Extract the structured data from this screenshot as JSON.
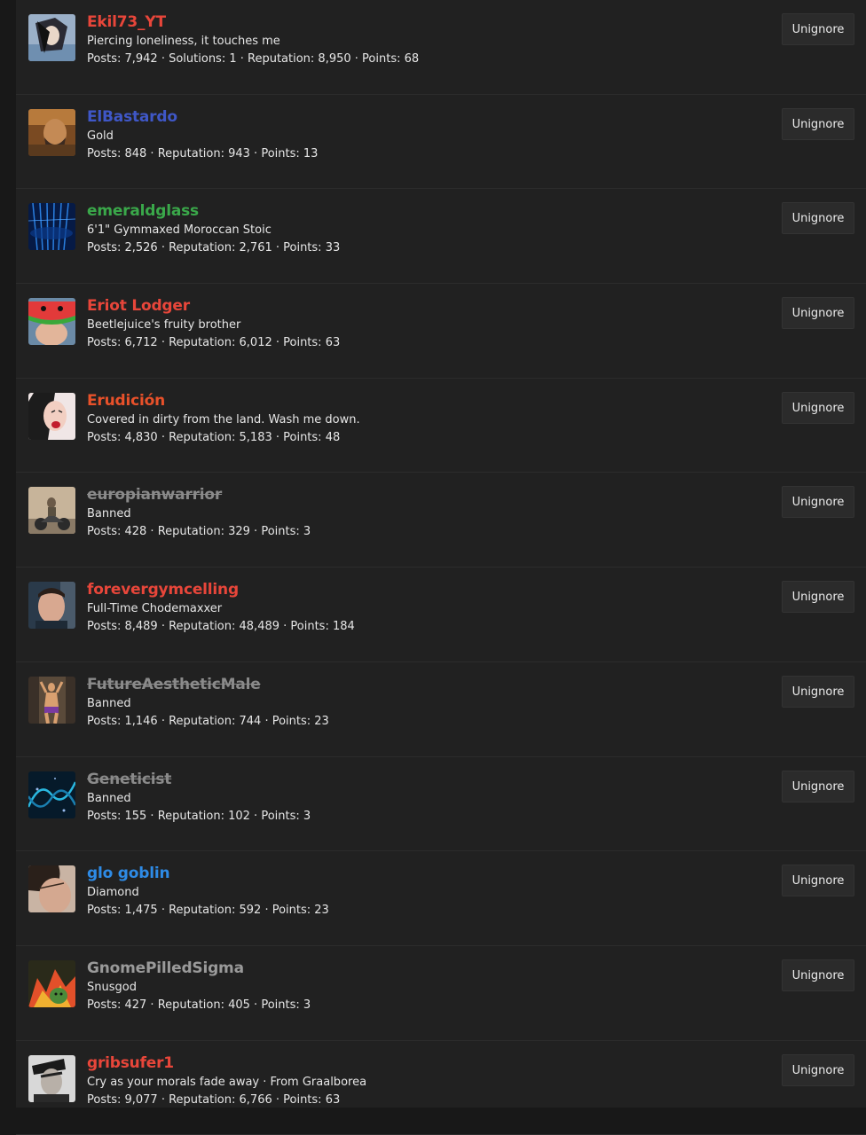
{
  "unignore_label": "Unignore",
  "users": [
    {
      "name": "Ekil73_YT",
      "color": "#e8463a",
      "banned": false,
      "title": "Piercing loneliness, it touches me",
      "stats": "Posts: 7,942 · Solutions: 1 · Reputation: 8,950 · Points: 68"
    },
    {
      "name": "ElBastardo",
      "color": "#3f57c7",
      "banned": false,
      "title": "Gold",
      "stats": "Posts: 848 · Reputation: 943 · Points: 13"
    },
    {
      "name": "emeraldglass",
      "color": "#3aa84a",
      "banned": false,
      "title": "6'1\" Gymmaxed Moroccan Stoic",
      "stats": "Posts: 2,526 · Reputation: 2,761 · Points: 33"
    },
    {
      "name": "Eriot Lodger",
      "color": "#e8463a",
      "banned": false,
      "title": "Beetlejuice's fruity brother",
      "stats": "Posts: 6,712 · Reputation: 6,012 · Points: 63"
    },
    {
      "name": "Erudición",
      "color": "#e8512a",
      "banned": false,
      "title": "Covered in dirty from the land. Wash me down.",
      "stats": "Posts: 4,830 · Reputation: 5,183 · Points: 48"
    },
    {
      "name": "europianwarrior",
      "color": "#8a8a8a",
      "banned": true,
      "title": "Banned",
      "stats": "Posts: 428 · Reputation: 329 · Points: 3"
    },
    {
      "name": "forevergymcelling",
      "color": "#e8463a",
      "banned": false,
      "title": "Full-Time Chodemaxxer",
      "stats": "Posts: 8,489 · Reputation: 48,489 · Points: 184"
    },
    {
      "name": "FutureAestheticMale",
      "color": "#8a8a8a",
      "banned": true,
      "title": "Banned",
      "stats": "Posts: 1,146 · Reputation: 744 · Points: 23"
    },
    {
      "name": "Geneticist",
      "color": "#8a8a8a",
      "banned": true,
      "title": "Banned",
      "stats": "Posts: 155 · Reputation: 102 · Points: 3"
    },
    {
      "name": "glo goblin",
      "color": "#2e8be6",
      "banned": false,
      "title": "Diamond",
      "stats": "Posts: 1,475 · Reputation: 592 · Points: 23"
    },
    {
      "name": "GnomePilledSigma",
      "color": "#9a9a9a",
      "banned": false,
      "title": "Snusgod",
      "stats": "Posts: 427 · Reputation: 405 · Points: 3"
    },
    {
      "name": "gribsufer1",
      "color": "#e8463a",
      "banned": false,
      "title": "Cry as your morals fade away · From Graalborea",
      "stats": "Posts: 9,077 · Reputation: 6,766 · Points: 63"
    }
  ]
}
